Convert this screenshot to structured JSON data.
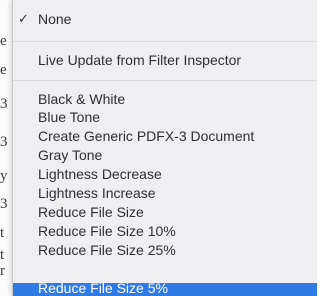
{
  "background_window": {
    "edge_glyphs": [
      "e",
      "e",
      "3",
      "3",
      "y",
      "3",
      "t",
      "t",
      "r"
    ]
  },
  "menu": {
    "checkmark": "✓",
    "items": [
      {
        "label": "None",
        "checked": true
      },
      {
        "label": "Live Update from Filter Inspector"
      },
      {
        "label": "Black & White"
      },
      {
        "label": "Blue Tone"
      },
      {
        "label": "Create Generic PDFX-3 Document"
      },
      {
        "label": "Gray Tone"
      },
      {
        "label": "Lightness Decrease"
      },
      {
        "label": "Lightness Increase"
      },
      {
        "label": "Reduce File Size"
      },
      {
        "label": "Reduce File Size 10%"
      },
      {
        "label": "Reduce File Size 25%"
      },
      {
        "label": "Reduce File Size 5%",
        "highlighted": true
      }
    ]
  },
  "colors": {
    "menu_background": "#efeff1",
    "highlight": "#2f7ae5",
    "text": "#2f2f33"
  }
}
